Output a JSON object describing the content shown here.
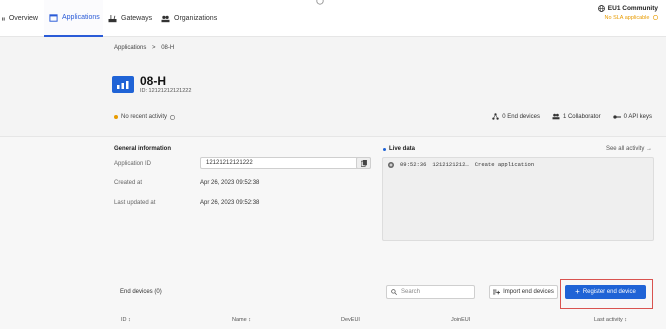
{
  "nav": {
    "tabs": [
      {
        "label": "Overview"
      },
      {
        "label": "Applications"
      },
      {
        "label": "Gateways"
      },
      {
        "label": "Organizations"
      }
    ],
    "community": "EU1 Community",
    "sla": "No SLA applicable"
  },
  "header": {
    "breadcrumb_root": "Applications",
    "breadcrumb_sep": ">",
    "breadcrumb_current": "08-H",
    "title": "08-H",
    "app_id_text": "ID: 12121212121222",
    "activity": "No recent activity",
    "stats": {
      "end_devices": "0 End devices",
      "collaborators": "1 Collaborator",
      "api_keys": "0 API keys"
    }
  },
  "general": {
    "heading": "General information",
    "application_id_label": "Application ID",
    "application_id_value": "12121212121222",
    "created_label": "Created at",
    "created_value": "Apr 26, 2023 09:52:38",
    "updated_label": "Last updated at",
    "updated_value": "Apr 26, 2023 09:52:38"
  },
  "live": {
    "heading": "Live data",
    "see_all": "See all activity →",
    "event_time": "09:52:36",
    "event_id": "1212121212…",
    "event_text": "Create application"
  },
  "devices": {
    "title": "End devices (0)",
    "search_placeholder": "Search",
    "import_label": "Import end devices",
    "register_label": "Register end device",
    "columns": [
      "ID ↕",
      "Name ↕",
      "DevEUI",
      "JoinEUI",
      "Last activity ↕"
    ]
  },
  "colors": {
    "accent": "#1f63d6",
    "warning": "#e89b00",
    "highlight_border": "#d9534f"
  }
}
